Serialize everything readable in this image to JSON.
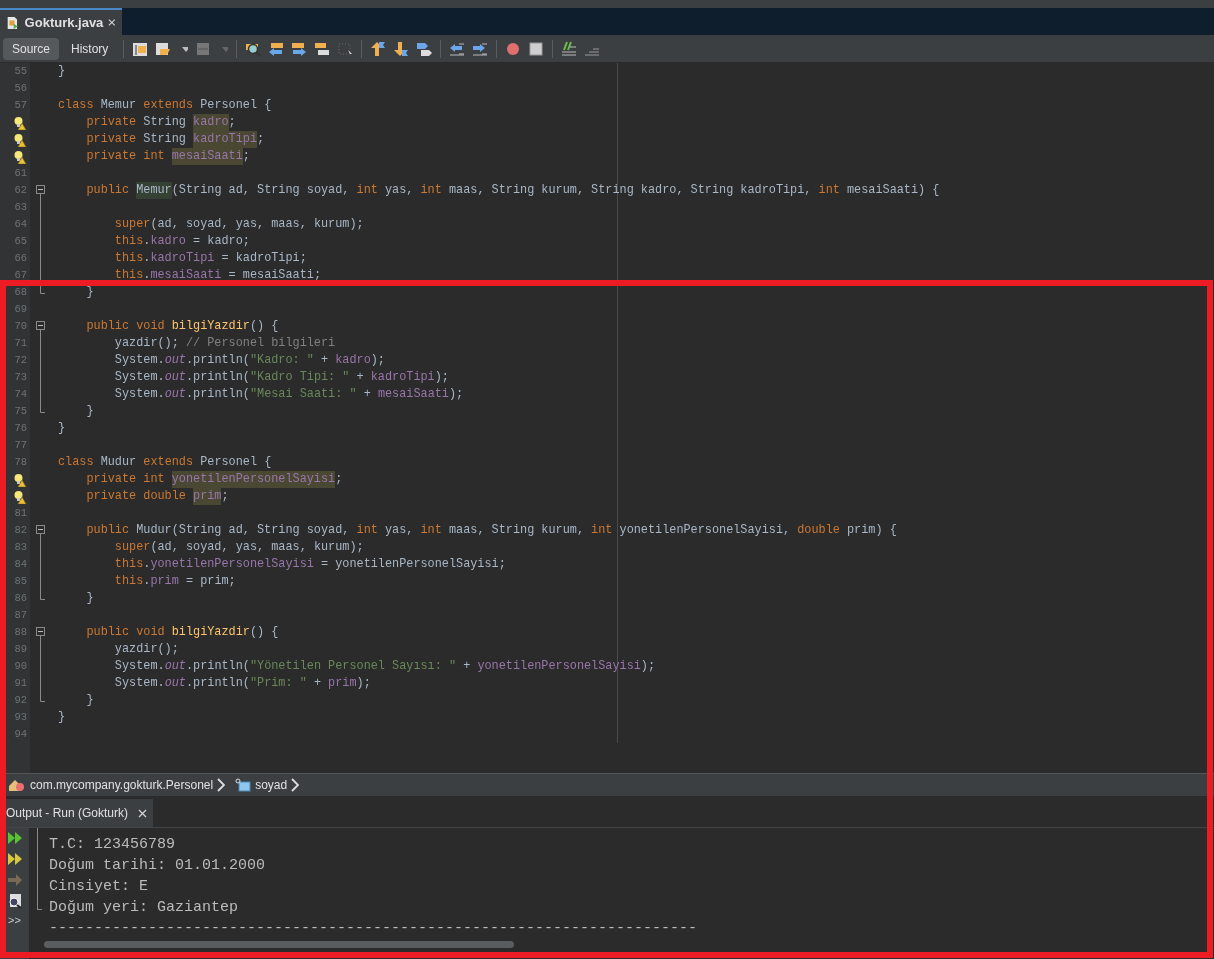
{
  "editor_tab": {
    "title": "Gokturk.java"
  },
  "view_tabs": [
    {
      "label": "Source",
      "selected": true
    },
    {
      "label": "History",
      "selected": false
    }
  ],
  "code_lines": [
    {
      "number": "55",
      "hint": false,
      "foldable": false,
      "fold_end": false,
      "tokens": [
        {
          "kind": "plain",
          "text": "}"
        }
      ]
    },
    {
      "number": "56",
      "hint": false,
      "foldable": false,
      "fold_end": false
    },
    {
      "number": "57",
      "hint": false,
      "foldable": false,
      "fold_end": false,
      "tokens": [
        {
          "kind": "keyword",
          "text": "class "
        },
        {
          "kind": "plain",
          "text": "Memur "
        },
        {
          "kind": "keyword",
          "text": "extends "
        },
        {
          "kind": "plain",
          "text": "Personel {"
        }
      ]
    },
    {
      "hint": true,
      "foldable": false,
      "fold_end": false,
      "tokens": [
        {
          "kind": "keyword",
          "text": "    private "
        },
        {
          "kind": "plain",
          "text": "String "
        },
        {
          "kind": "field-mark",
          "text": "kadro"
        },
        {
          "kind": "plain",
          "text": ";"
        }
      ]
    },
    {
      "hint": true,
      "foldable": false,
      "fold_end": false,
      "tokens": [
        {
          "kind": "keyword",
          "text": "    private "
        },
        {
          "kind": "plain",
          "text": "String "
        },
        {
          "kind": "field-mark",
          "text": "kadroTipi"
        },
        {
          "kind": "plain",
          "text": ";"
        }
      ]
    },
    {
      "hint": true,
      "foldable": false,
      "fold_end": false,
      "tokens": [
        {
          "kind": "keyword",
          "text": "    private int "
        },
        {
          "kind": "field-mark",
          "text": "mesaiSaati"
        },
        {
          "kind": "plain",
          "text": ";"
        }
      ]
    },
    {
      "number": "61",
      "hint": false,
      "foldable": false,
      "fold_end": false
    },
    {
      "number": "62",
      "hint": false,
      "foldable": true,
      "fold_end": false,
      "tokens": [
        {
          "kind": "keyword",
          "text": "    public "
        },
        {
          "kind": "class-mark",
          "text": "Memur"
        },
        {
          "kind": "plain",
          "text": "(String ad, String soyad, "
        },
        {
          "kind": "keyword",
          "text": "int "
        },
        {
          "kind": "plain",
          "text": "yas, "
        },
        {
          "kind": "keyword",
          "text": "int "
        },
        {
          "kind": "plain",
          "text": "maas, String kurum, String kadro, String kadroTipi, "
        },
        {
          "kind": "keyword",
          "text": "int "
        },
        {
          "kind": "plain",
          "text": "mesaiSaati) {"
        }
      ]
    },
    {
      "number": "63",
      "hint": false,
      "foldable": false,
      "fold_end": false
    },
    {
      "number": "64",
      "hint": false,
      "foldable": false,
      "fold_end": false,
      "tokens": [
        {
          "kind": "keyword",
          "text": "        super"
        },
        {
          "kind": "plain",
          "text": "(ad, soyad, yas, maas, kurum);"
        }
      ]
    },
    {
      "number": "65",
      "hint": false,
      "foldable": false,
      "fold_end": false,
      "tokens": [
        {
          "kind": "keyword",
          "text": "        this"
        },
        {
          "kind": "plain",
          "text": "."
        },
        {
          "kind": "field",
          "text": "kadro"
        },
        {
          "kind": "plain",
          "text": " = kadro;"
        }
      ]
    },
    {
      "number": "66",
      "hint": false,
      "foldable": false,
      "fold_end": false,
      "tokens": [
        {
          "kind": "keyword",
          "text": "        this"
        },
        {
          "kind": "plain",
          "text": "."
        },
        {
          "kind": "field",
          "text": "kadroTipi"
        },
        {
          "kind": "plain",
          "text": " = kadroTipi;"
        }
      ]
    },
    {
      "number": "67",
      "hint": false,
      "foldable": false,
      "fold_end": false,
      "tokens": [
        {
          "kind": "keyword",
          "text": "        this"
        },
        {
          "kind": "plain",
          "text": "."
        },
        {
          "kind": "field",
          "text": "mesaiSaati"
        },
        {
          "kind": "plain",
          "text": " = mesaiSaati;"
        }
      ]
    },
    {
      "number": "68",
      "hint": false,
      "foldable": false,
      "fold_end": true,
      "tokens": [
        {
          "kind": "plain",
          "text": "    }"
        }
      ]
    },
    {
      "number": "69",
      "hint": false,
      "foldable": false,
      "fold_end": false
    },
    {
      "number": "70",
      "hint": false,
      "foldable": true,
      "fold_end": false,
      "tokens": [
        {
          "kind": "keyword",
          "text": "    public void "
        },
        {
          "kind": "method",
          "text": "bilgiYazdir"
        },
        {
          "kind": "plain",
          "text": "() {"
        }
      ]
    },
    {
      "number": "71",
      "hint": false,
      "foldable": false,
      "fold_end": false,
      "tokens": [
        {
          "kind": "plain",
          "text": "        yazdir(); "
        },
        {
          "kind": "comment",
          "text": "// Personel bilgileri"
        }
      ]
    },
    {
      "number": "72",
      "hint": false,
      "foldable": false,
      "fold_end": false,
      "tokens": [
        {
          "kind": "plain",
          "text": "        System."
        },
        {
          "kind": "static",
          "text": "out"
        },
        {
          "kind": "plain",
          "text": ".println("
        },
        {
          "kind": "string",
          "text": "\"Kadro: \""
        },
        {
          "kind": "plain",
          "text": " + "
        },
        {
          "kind": "field",
          "text": "kadro"
        },
        {
          "kind": "plain",
          "text": ");"
        }
      ]
    },
    {
      "number": "73",
      "hint": false,
      "foldable": false,
      "fold_end": false,
      "tokens": [
        {
          "kind": "plain",
          "text": "        System."
        },
        {
          "kind": "static",
          "text": "out"
        },
        {
          "kind": "plain",
          "text": ".println("
        },
        {
          "kind": "string",
          "text": "\"Kadro Tipi: \""
        },
        {
          "kind": "plain",
          "text": " + "
        },
        {
          "kind": "field",
          "text": "kadroTipi"
        },
        {
          "kind": "plain",
          "text": ");"
        }
      ]
    },
    {
      "number": "74",
      "hint": false,
      "foldable": false,
      "fold_end": false,
      "tokens": [
        {
          "kind": "plain",
          "text": "        System."
        },
        {
          "kind": "static",
          "text": "out"
        },
        {
          "kind": "plain",
          "text": ".println("
        },
        {
          "kind": "string",
          "text": "\"Mesai Saati: \""
        },
        {
          "kind": "plain",
          "text": " + "
        },
        {
          "kind": "field",
          "text": "mesaiSaati"
        },
        {
          "kind": "plain",
          "text": ");"
        }
      ]
    },
    {
      "number": "75",
      "hint": false,
      "foldable": false,
      "fold_end": true,
      "tokens": [
        {
          "kind": "plain",
          "text": "    }"
        }
      ]
    },
    {
      "number": "76",
      "hint": false,
      "foldable": false,
      "fold_end": false,
      "tokens": [
        {
          "kind": "plain",
          "text": "}"
        }
      ]
    },
    {
      "number": "77",
      "hint": false,
      "foldable": false,
      "fold_end": false
    },
    {
      "number": "78",
      "hint": false,
      "foldable": false,
      "fold_end": false,
      "tokens": [
        {
          "kind": "keyword",
          "text": "class "
        },
        {
          "kind": "plain",
          "text": "Mudur "
        },
        {
          "kind": "keyword",
          "text": "extends "
        },
        {
          "kind": "plain",
          "text": "Personel {"
        }
      ]
    },
    {
      "hint": true,
      "foldable": false,
      "fold_end": false,
      "tokens": [
        {
          "kind": "keyword",
          "text": "    private int "
        },
        {
          "kind": "field-mark",
          "text": "yonetilenPersonelSayisi"
        },
        {
          "kind": "plain",
          "text": ";"
        }
      ]
    },
    {
      "hint": true,
      "foldable": false,
      "fold_end": false,
      "tokens": [
        {
          "kind": "keyword",
          "text": "    private double "
        },
        {
          "kind": "field-mark",
          "text": "prim"
        },
        {
          "kind": "plain",
          "text": ";"
        }
      ]
    },
    {
      "number": "81",
      "hint": false,
      "foldable": false,
      "fold_end": false
    },
    {
      "number": "82",
      "hint": false,
      "foldable": true,
      "fold_end": false,
      "tokens": [
        {
          "kind": "keyword",
          "text": "    public "
        },
        {
          "kind": "plain",
          "text": "Mudur(String ad, String soyad, "
        },
        {
          "kind": "keyword",
          "text": "int "
        },
        {
          "kind": "plain",
          "text": "yas, "
        },
        {
          "kind": "keyword",
          "text": "int "
        },
        {
          "kind": "plain",
          "text": "maas, String kurum, "
        },
        {
          "kind": "keyword",
          "text": "int "
        },
        {
          "kind": "plain",
          "text": "yonetilenPersonelSayisi, "
        },
        {
          "kind": "keyword",
          "text": "double "
        },
        {
          "kind": "plain",
          "text": "prim) {"
        }
      ]
    },
    {
      "number": "83",
      "hint": false,
      "foldable": false,
      "fold_end": false,
      "tokens": [
        {
          "kind": "keyword",
          "text": "        super"
        },
        {
          "kind": "plain",
          "text": "(ad, soyad, yas, maas, kurum);"
        }
      ]
    },
    {
      "number": "84",
      "hint": false,
      "foldable": false,
      "fold_end": false,
      "tokens": [
        {
          "kind": "keyword",
          "text": "        this"
        },
        {
          "kind": "plain",
          "text": "."
        },
        {
          "kind": "field",
          "text": "yonetilenPersonelSayisi"
        },
        {
          "kind": "plain",
          "text": " = yonetilenPersonelSayisi;"
        }
      ]
    },
    {
      "number": "85",
      "hint": false,
      "foldable": false,
      "fold_end": false,
      "tokens": [
        {
          "kind": "keyword",
          "text": "        this"
        },
        {
          "kind": "plain",
          "text": "."
        },
        {
          "kind": "field",
          "text": "prim"
        },
        {
          "kind": "plain",
          "text": " = prim;"
        }
      ]
    },
    {
      "number": "86",
      "hint": false,
      "foldable": false,
      "fold_end": true,
      "tokens": [
        {
          "kind": "plain",
          "text": "    }"
        }
      ]
    },
    {
      "number": "87",
      "hint": false,
      "foldable": false,
      "fold_end": false
    },
    {
      "number": "88",
      "hint": false,
      "foldable": true,
      "fold_end": false,
      "tokens": [
        {
          "kind": "keyword",
          "text": "    public void "
        },
        {
          "kind": "method",
          "text": "bilgiYazdir"
        },
        {
          "kind": "plain",
          "text": "() {"
        }
      ]
    },
    {
      "number": "89",
      "hint": false,
      "foldable": false,
      "fold_end": false,
      "tokens": [
        {
          "kind": "plain",
          "text": "        yazdir();"
        }
      ]
    },
    {
      "number": "90",
      "hint": false,
      "foldable": false,
      "fold_end": false,
      "tokens": [
        {
          "kind": "plain",
          "text": "        System."
        },
        {
          "kind": "static",
          "text": "out"
        },
        {
          "kind": "plain",
          "text": ".println("
        },
        {
          "kind": "string",
          "text": "\"Yönetilen Personel Sayısı: \""
        },
        {
          "kind": "plain",
          "text": " + "
        },
        {
          "kind": "field",
          "text": "yonetilenPersonelSayisi"
        },
        {
          "kind": "plain",
          "text": ");"
        }
      ]
    },
    {
      "number": "91",
      "hint": false,
      "foldable": false,
      "fold_end": false,
      "tokens": [
        {
          "kind": "plain",
          "text": "        System."
        },
        {
          "kind": "static",
          "text": "out"
        },
        {
          "kind": "plain",
          "text": ".println("
        },
        {
          "kind": "string",
          "text": "\"Prim: \""
        },
        {
          "kind": "plain",
          "text": " + "
        },
        {
          "kind": "field",
          "text": "prim"
        },
        {
          "kind": "plain",
          "text": ");"
        }
      ]
    },
    {
      "number": "92",
      "hint": false,
      "foldable": false,
      "fold_end": true,
      "tokens": [
        {
          "kind": "plain",
          "text": "    }"
        }
      ]
    },
    {
      "number": "93",
      "hint": false,
      "foldable": false,
      "fold_end": false,
      "tokens": [
        {
          "kind": "plain",
          "text": "}"
        }
      ]
    },
    {
      "number": "94",
      "hint": false,
      "foldable": false,
      "fold_end": false
    }
  ],
  "breadcrumbs": [
    {
      "kind": "class",
      "label": "com.mycompany.gokturk.Personel"
    },
    {
      "kind": "field",
      "label": "soyad"
    }
  ],
  "output_tab": {
    "title": "Output - Run (Gokturk)"
  },
  "output_lines": [
    "T.C: 123456789",
    "Doğum tarihi: 01.01.2000",
    "Cinsiyet: E",
    "Doğum yeri: Gaziantep",
    "------------------------------------------------------------------------"
  ],
  "output_more": ">>"
}
